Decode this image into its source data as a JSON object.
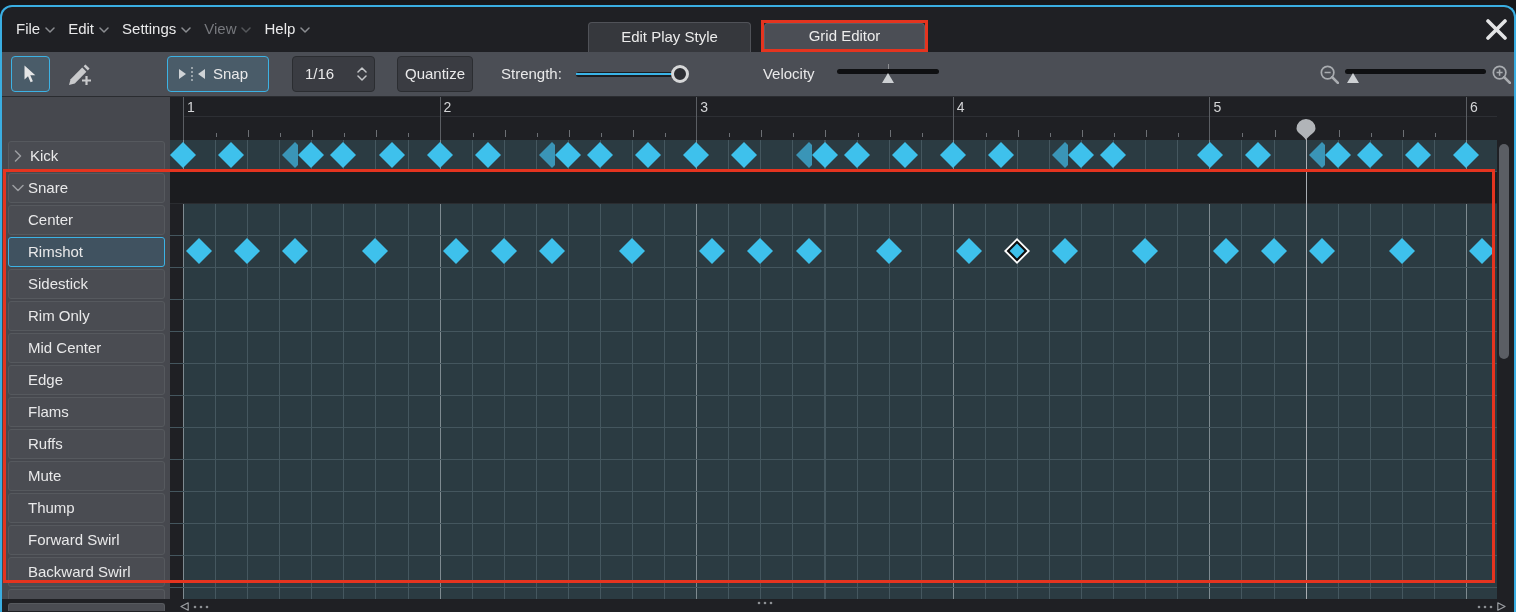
{
  "menu": [
    {
      "label": "File",
      "disabled": false
    },
    {
      "label": "Edit",
      "disabled": false
    },
    {
      "label": "Settings",
      "disabled": false
    },
    {
      "label": "View",
      "disabled": true
    },
    {
      "label": "Help",
      "disabled": false
    }
  ],
  "tabs": [
    {
      "label": "Edit Play Style",
      "selected": false,
      "highlighted": false
    },
    {
      "label": "Grid Editor",
      "selected": true,
      "highlighted": true
    }
  ],
  "toolbar": {
    "tools": [
      {
        "kind": "pointer",
        "selected": true
      },
      {
        "kind": "pencil",
        "selected": false
      }
    ],
    "snap": {
      "label": "Snap",
      "on": true
    },
    "grid_resolution": {
      "value": "1/16"
    },
    "quantize": {
      "label": "Quantize"
    },
    "strength": {
      "label": "Strength:",
      "level": 0.93
    },
    "velocity": {
      "label": "Velocity",
      "level": 0.5
    },
    "zoom": {
      "level": 0.06
    }
  },
  "ruler": {
    "bars": [
      "1",
      "2",
      "3",
      "4",
      "5",
      "6"
    ]
  },
  "tracks": [
    {
      "label": "Kick",
      "expanded": false,
      "selected": false,
      "highlighted": false,
      "notes": [
        {
          "ghost": false,
          "selected": false
        },
        {
          "ghost": false,
          "selected": false
        },
        {
          "ghost": true,
          "selected": false
        },
        {
          "ghost": false,
          "selected": false
        },
        {
          "ghost": false,
          "selected": false
        },
        {
          "ghost": false,
          "selected": false
        },
        {
          "ghost": false,
          "selected": false
        },
        {
          "ghost": false,
          "selected": false
        },
        {
          "ghost": true,
          "selected": false
        },
        {
          "ghost": false,
          "selected": false
        },
        {
          "ghost": false,
          "selected": false
        },
        {
          "ghost": false,
          "selected": false
        },
        {
          "ghost": false,
          "selected": false
        },
        {
          "ghost": false,
          "selected": false
        },
        {
          "ghost": true,
          "selected": false
        },
        {
          "ghost": false,
          "selected": false
        },
        {
          "ghost": false,
          "selected": false
        },
        {
          "ghost": false,
          "selected": false
        },
        {
          "ghost": false,
          "selected": false
        },
        {
          "ghost": false,
          "selected": false
        },
        {
          "ghost": true,
          "selected": false
        },
        {
          "ghost": false,
          "selected": false
        },
        {
          "ghost": false,
          "selected": false
        },
        {
          "ghost": false,
          "selected": false
        },
        {
          "ghost": false,
          "selected": false
        },
        {
          "ghost": true,
          "selected": false
        },
        {
          "ghost": false,
          "selected": false
        },
        {
          "ghost": false,
          "selected": false
        },
        {
          "ghost": false,
          "selected": false
        },
        {
          "ghost": false,
          "selected": false
        }
      ]
    },
    {
      "label": "Snare",
      "expanded": true,
      "selected": false,
      "highlighted": true,
      "children": [
        {
          "label": "Center",
          "selected": false
        },
        {
          "label": "Rimshot",
          "selected": true,
          "notes": [
            {
              "ghost": false,
              "selected": false
            },
            {
              "ghost": false,
              "selected": false
            },
            {
              "ghost": false,
              "selected": false
            },
            {
              "ghost": false,
              "selected": false
            },
            {
              "ghost": false,
              "selected": false
            },
            {
              "ghost": false,
              "selected": false
            },
            {
              "ghost": false,
              "selected": false
            },
            {
              "ghost": false,
              "selected": false
            },
            {
              "ghost": false,
              "selected": false
            },
            {
              "ghost": false,
              "selected": false
            },
            {
              "ghost": false,
              "selected": false
            },
            {
              "ghost": false,
              "selected": false
            },
            {
              "ghost": false,
              "selected": false
            },
            {
              "ghost": false,
              "selected": true
            },
            {
              "ghost": false,
              "selected": false
            },
            {
              "ghost": false,
              "selected": false
            },
            {
              "ghost": false,
              "selected": false
            },
            {
              "ghost": false,
              "selected": false
            },
            {
              "ghost": false,
              "selected": false
            },
            {
              "ghost": false,
              "selected": false
            },
            {
              "ghost": false,
              "selected": false
            }
          ]
        },
        {
          "label": "Sidestick",
          "selected": false
        },
        {
          "label": "Rim Only",
          "selected": false
        },
        {
          "label": "Mid Center",
          "selected": false
        },
        {
          "label": "Edge",
          "selected": false
        },
        {
          "label": "Flams",
          "selected": false
        },
        {
          "label": "Ruffs",
          "selected": false
        },
        {
          "label": "Mute",
          "selected": false
        },
        {
          "label": "Thump",
          "selected": false
        },
        {
          "label": "Forward Swirl",
          "selected": false
        },
        {
          "label": "Backward Swirl",
          "selected": false
        }
      ]
    }
  ]
}
